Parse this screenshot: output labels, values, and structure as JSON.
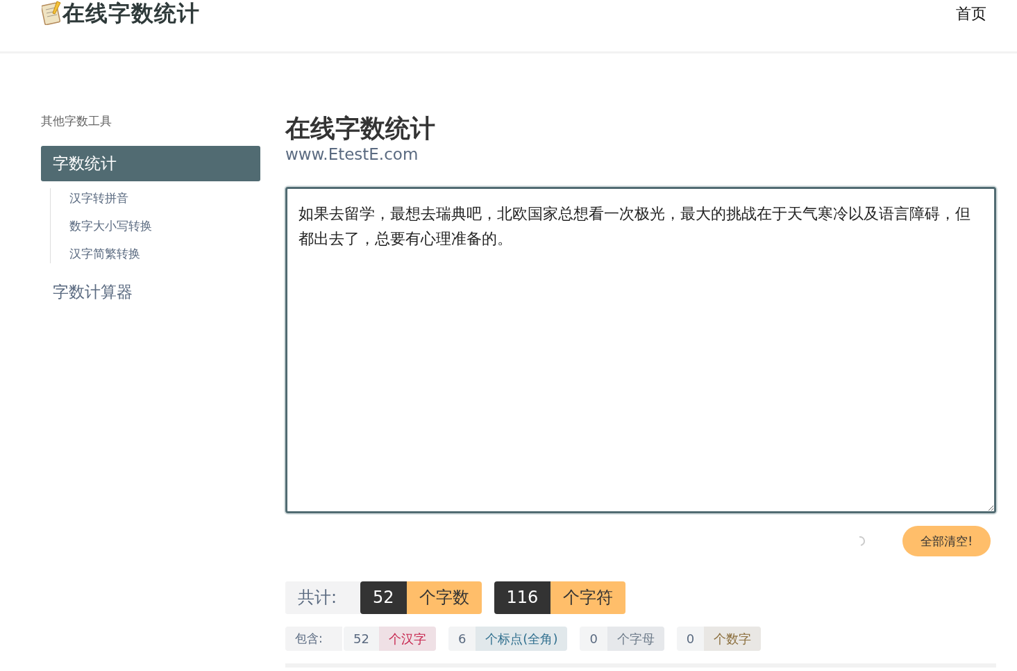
{
  "header": {
    "logo_text": "在线字数统计",
    "nav": [
      {
        "label": "首页"
      }
    ]
  },
  "sidebar": {
    "title": "其他字数工具",
    "items": [
      {
        "label": "字数统计",
        "selected": true,
        "children": [
          {
            "label": "汉字转拼音"
          },
          {
            "label": "数字大小写转换"
          },
          {
            "label": "汉字简繁转换"
          }
        ]
      },
      {
        "label": "字数计算器",
        "selected": false
      }
    ]
  },
  "main": {
    "title": "在线字数统计",
    "subtitle": "www.EtestE.com",
    "textarea": {
      "value": "如果去留学，最想去瑞典吧，北欧国家总想看一次极光，最大的挑战在于天气寒冷以及语言障碍，但都出去了，总要有心理准备的。"
    },
    "clear_button": "全部清空!",
    "totals": {
      "label": "共计:",
      "items": [
        {
          "value": "52",
          "unit": "个字数"
        },
        {
          "value": "116",
          "unit": "个字符"
        }
      ]
    },
    "contains": {
      "label": "包含:",
      "items": [
        {
          "value": "52",
          "unit": "个汉字",
          "color": "#c7254e"
        },
        {
          "value": "6",
          "unit": "个标点(全角)",
          "color": "#31708f"
        },
        {
          "value": "0",
          "unit": "个字母",
          "color": "#6c7a89"
        },
        {
          "value": "0",
          "unit": "个数字",
          "color": "#8a6d3b"
        }
      ]
    }
  }
}
